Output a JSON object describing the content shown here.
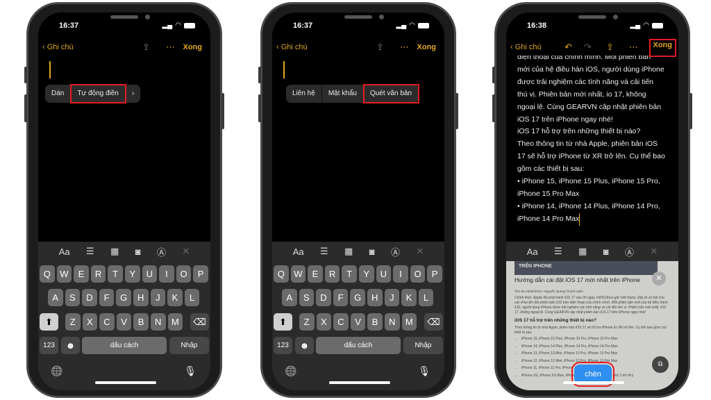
{
  "accent_color": "#e3a721",
  "highlight_color": "#e51c23",
  "phones": [
    {
      "time": "16:37",
      "back_label": "Ghi chú",
      "done_label": "Xong",
      "done_highlighted": false,
      "nav_icons": [
        "share-icon",
        "more-icon"
      ],
      "popup": {
        "items": [
          "Dán",
          "Tự động điền"
        ],
        "highlighted": 1,
        "has_more_arrow": true,
        "more_arrow": "›"
      },
      "mode": "keyboard"
    },
    {
      "time": "16:37",
      "back_label": "Ghi chú",
      "done_label": "Xong",
      "done_highlighted": false,
      "nav_icons": [
        "share-icon",
        "more-icon"
      ],
      "popup": {
        "items": [
          "Liên hệ",
          "Mật khẩu",
          "Quét văn bản"
        ],
        "highlighted": 2,
        "has_more_arrow": false
      },
      "mode": "keyboard"
    },
    {
      "time": "16:38",
      "back_label": "Ghi chú",
      "done_label": "Xong",
      "done_highlighted": true,
      "nav_icons": [
        "undo-icon",
        "redo-icon",
        "share-icon",
        "more-icon"
      ],
      "note_lines": [
        "điện thoại của chính mình. Mỗi phiên bản",
        "mới của hệ điều hàn iOS, người dùng iPhone",
        "được trải nghiệm các tính năng và cải tiến",
        "thú vị. Phiên bản mới nhất, io 17, không",
        "ngoại lệ. Cùng GEARVN cập nhật phiên bản",
        "iOS 17 trên iPhone ngay nhé!",
        "iOS 17 hỗ trợ trên những thiết bị nào?",
        "Theo thông tin từ nhà Apple, phiên bản iOS",
        "17 sẽ hỗ trợ iPhone từ XR trở lên. Cụ thể bao",
        "gồm các thiết bị sau:",
        "• iPhone 15, iPhone 15 Plus, iPhone 15 Pro,",
        "iPhone 15 Pro Max",
        "• iPhone 14, iPhone 14 Plus, iPhone 14 Pro,",
        "iPhone 14 Pro Max"
      ],
      "preview": {
        "banner": "TRÊN IPHONE",
        "title": "Hướng dẫn cài đặt iOS 17 mới nhất trên iPhone",
        "meta": "Thứ Ba 19/09/2023 • Nguyễn Quang Thanh Uyên",
        "intro": "Chính thức: Apple đã phát hành iOS 17 vào 0h ngày 19/09 (theo giờ Việt Nam). Đây là cơ hội cho các iFan lên đời phiên bản iOS trên điện thoại của chính mình. Mỗi phiên bản mới của hệ điều hành iOS, người dùng iPhone được trải nghiệm các tính năng và cải tiến thú vị. Phiên bản mới nhất, iOS 17, không ngoại lệ. Cùng GEARVN cập nhật phiên bản iOS 17 trên iPhone ngay nhé!",
        "heading": "iOS 17 hỗ trợ trên những thiết bị nào?",
        "para": "Theo thông tin từ nhà Apple, phiên bản iOS 17 sẽ hỗ trợ iPhone từ XR trở lên. Cụ thể bao gồm các thiết bị sau:",
        "list": [
          "iPhone 15, iPhone 15 Plus, iPhone 15 Pro, iPhone 15 Pro Max",
          "iPhone 14, iPhone 14 Plus, iPhone 14 Pro, iPhone 14 Pro Max",
          "iPhone 13, iPhone 13 Mini, iPhone 13 Pro, iPhone 13 Pro Max",
          "iPhone 12, iPhone 12 Mini, iPhone 12 Pro, iPhone 12 Pro Max",
          "iPhone 11, iPhone 11 Pro, iPhone 11 Pro Max",
          "iPhone XS, iPhone XS Max, iPhone XR, iPhone SE (thế hệ thứ 2 trở lên)"
        ],
        "insert_label": "chèn",
        "close": "✕",
        "scan": "⧉"
      },
      "mode": "camera"
    }
  ],
  "toolbar": {
    "format": "Aa",
    "icons": [
      "checklist-icon",
      "table-icon",
      "camera-icon",
      "markup-icon",
      "close-icon"
    ],
    "glyphs": [
      "☰",
      "▦",
      "◙",
      "Ⓐ",
      "✕"
    ]
  },
  "keyboard": {
    "rows": [
      [
        "Q",
        "W",
        "E",
        "R",
        "T",
        "Y",
        "U",
        "I",
        "O",
        "P"
      ],
      [
        "A",
        "S",
        "D",
        "F",
        "G",
        "H",
        "J",
        "K",
        "L"
      ],
      [
        "Z",
        "X",
        "C",
        "V",
        "B",
        "N",
        "M"
      ]
    ],
    "shift": "⬆",
    "backspace": "⌫",
    "numbers": "123",
    "emoji": "☻",
    "space": "dấu cách",
    "return": "Nhập",
    "globe": "🌐",
    "mic": "🎙"
  }
}
